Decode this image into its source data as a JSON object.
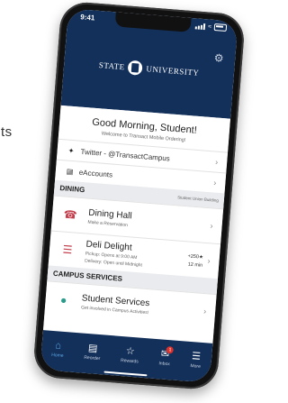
{
  "background_text": "ts",
  "status": {
    "time": "9:41"
  },
  "header": {
    "logo_left": "STATE",
    "logo_right": "UNIVERSITY"
  },
  "greeting": {
    "title": "Good Morning, Student!",
    "subtitle": "Welcome to Transact Mobile Ordering!"
  },
  "links": [
    {
      "icon": "twitter-icon",
      "label": "Twitter - @TransactCampus"
    },
    {
      "icon": "eaccounts-icon",
      "label": "eAccounts"
    }
  ],
  "dining": {
    "header": "DINING",
    "note": "Student Union Building",
    "items": [
      {
        "title": "Dining Hall",
        "sub": "Make a Reservation"
      },
      {
        "title": "Deli Delight",
        "sub_line1": "Pickup: Opens at 9:00 AM",
        "sub_line2": "Delivery: Open until Midnight",
        "meta_line1": "+250★",
        "meta_line2": "12 min"
      }
    ]
  },
  "campus": {
    "header": "CAMPUS SERVICES",
    "items": [
      {
        "title": "Student Services",
        "sub": "Get involved in Campus Activities!"
      }
    ]
  },
  "tabs": [
    {
      "label": "Home",
      "active": true
    },
    {
      "label": "Reorder",
      "active": false
    },
    {
      "label": "Rewards",
      "active": false
    },
    {
      "label": "Inbox",
      "active": false,
      "badge": "1"
    },
    {
      "label": "More",
      "active": false
    }
  ],
  "colors": {
    "brand": "#13305a",
    "accent": "#5aa7e6",
    "badge": "#d9322e"
  }
}
